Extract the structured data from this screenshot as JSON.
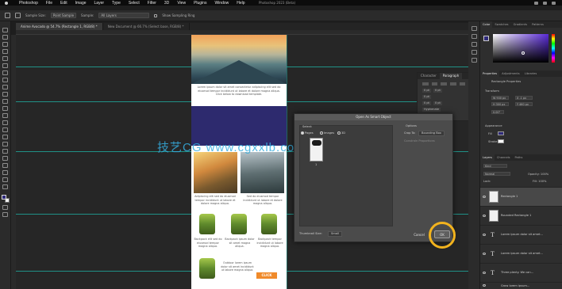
{
  "menubar": {
    "items": [
      "Photoshop",
      "File",
      "Edit",
      "Image",
      "Layer",
      "Type",
      "Select",
      "Filter",
      "3D",
      "View",
      "Plugins",
      "Window",
      "Help"
    ],
    "window_title": "Photoshop 2023 (Beta)"
  },
  "options_bar": {
    "select_label": "Sample Size:",
    "select_value": "Point Sample",
    "sample_label": "Sample:",
    "sample_value": "All Layers",
    "show_ring": "Show Sampling Ring"
  },
  "document_tabs": [
    {
      "label": "Anime Avocado @ 54.7% (Rectangle 1, RGB/8) *",
      "active": true
    },
    {
      "label": "New Document @ 66.7% (Select base, RGB/8) *",
      "active": false
    }
  ],
  "float_panel": {
    "tabs": [
      "Character",
      "Paragraph"
    ],
    "active_tab": "Paragraph",
    "fields": [
      "0 pt",
      "0 pt",
      "0 pt",
      "0 pt",
      "0 pt"
    ],
    "hyphenate": "Hyphenate"
  },
  "document": {
    "para1": "Lorem ipsum dolor sit amet consectetur adipiscing elit sed do eiusmod tempor incididunt ut labore et dolore magna aliqua. Click below to download template.",
    "para2": "Adipiscing elit sed do eiusmod tempor incididunt ut labore et dolore magna aliqua.",
    "para3": "Sed do eiusmod tempor incididunt ut labore et dolore magna aliqua.",
    "pack1": "Backpack elit sed do eiusmod tempor magna aliqua.",
    "pack2": "Backpack ipsum dolor sit amet magna aliqua.",
    "pack3": "Backpack tempor incididunt ut labore magna aliqua.",
    "pack4": "Outdoor lorem ipsum dolor sit amet incididunt ut labore magna aliqua.",
    "click_label": "CLICK"
  },
  "watermark": "技艺CG www.cgxxlb.com",
  "dialog": {
    "title": "Open As Smart Object",
    "options_group": "Options",
    "option_pages": "Pages",
    "option_images": "Images",
    "option_3d": "3D",
    "crop_to_label": "Crop To:",
    "crop_to_value": "Bounding Box",
    "constrain": "Constrain Proportions",
    "page_number": "1",
    "thumb_label": "Thumbnail Size:",
    "thumb_value": "Small",
    "cancel": "Cancel",
    "ok": "OK"
  },
  "panels": {
    "color_tabs": [
      "Color",
      "Swatches",
      "Gradients",
      "Patterns"
    ],
    "properties_tabs": [
      "Properties",
      "Adjustments",
      "Libraries"
    ],
    "properties_title": "Rectangle Properties",
    "transform": "Transform",
    "w": "W  900 px",
    "h": "H  300 px",
    "x": "X  -1 px",
    "y": "Y  460 px",
    "angle": "0.00°",
    "appearance": "Appearance",
    "fill": "Fill",
    "stroke": "Stroke",
    "layer_tabs": [
      "Layers",
      "Channels",
      "Paths"
    ],
    "kind": "Kind",
    "blend": "Normal",
    "opacity": "Opacity: 100%",
    "lock": "Lock:",
    "fill_pct": "Fill: 100%",
    "layers": [
      {
        "name": "Rectangle 1",
        "type": "image",
        "selected": true
      },
      {
        "name": "Rounded Rectangle 1",
        "type": "image",
        "selected": false
      },
      {
        "name": "Lorem ipsum dolor sit amet...",
        "type": "text",
        "selected": false
      },
      {
        "name": "Lorem ipsum dolor sit amet...",
        "type": "text",
        "selected": false
      },
      {
        "name": "Three plenty. We can...",
        "type": "text",
        "selected": false
      },
      {
        "name": "Grow lorem ipsum... ",
        "type": "text",
        "selected": false
      }
    ]
  }
}
